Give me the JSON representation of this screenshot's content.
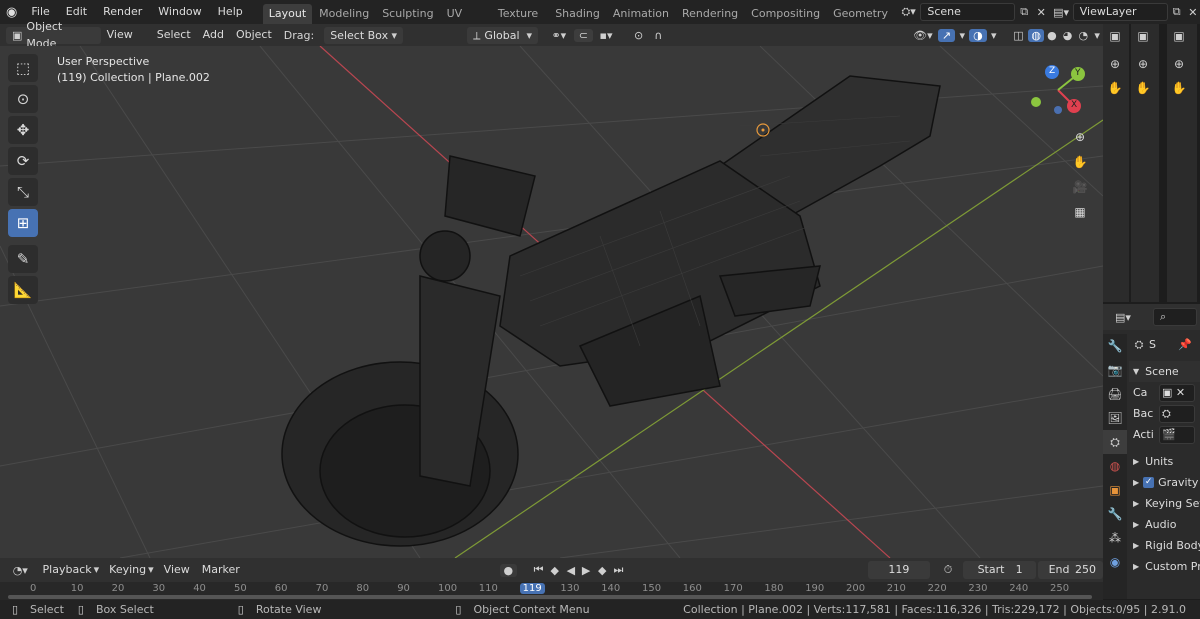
{
  "menubar": {
    "items": [
      "File",
      "Edit",
      "Render",
      "Window",
      "Help"
    ],
    "workspaces": [
      "Layout",
      "Modeling",
      "Sculpting",
      "UV Editing",
      "Texture Paint",
      "Shading",
      "Animation",
      "Rendering",
      "Compositing",
      "Geometry Nod"
    ],
    "active_workspace": "Layout",
    "scene": "Scene",
    "view_layer": "ViewLayer"
  },
  "header": {
    "mode": "Object Mode",
    "menus": [
      "View",
      "Select",
      "Add",
      "Object"
    ],
    "drag_label": "Drag:",
    "drag_value": "Select Box",
    "transform_orientation": "Global"
  },
  "viewport": {
    "view_name": "User Perspective",
    "collection_info": "(119) Collection | Plane.002",
    "gizmo_axes": {
      "x": "X",
      "y": "Y",
      "z": "Z"
    },
    "axis_colors": {
      "x": "#e0404f",
      "y": "#8bc53f",
      "z": "#3a7be0"
    }
  },
  "properties": {
    "search_placeholder": "",
    "breadcrumb": "S",
    "section": "Scene",
    "fields": [
      {
        "label": "Ca"
      },
      {
        "label": "Bac"
      },
      {
        "label": "Acti"
      }
    ],
    "panels": [
      "Units",
      "Gravity",
      "Keying Set",
      "Audio",
      "Rigid Body",
      "Custom Pr"
    ],
    "gravity_checked": true
  },
  "timeline": {
    "menus": [
      "Playback",
      "Keying",
      "View",
      "Marker"
    ],
    "current_frame": "119",
    "start_label": "Start",
    "start_value": "1",
    "end_label": "End",
    "end_value": "250",
    "ruler": [
      "0",
      "10",
      "20",
      "30",
      "40",
      "50",
      "60",
      "70",
      "80",
      "90",
      "100",
      "110",
      "119",
      "130",
      "140",
      "150",
      "160",
      "170",
      "180",
      "190",
      "200",
      "210",
      "220",
      "230",
      "240",
      "250"
    ],
    "playhead": "119"
  },
  "statusbar": {
    "select": "Select",
    "box_select": "Box Select",
    "rotate_view": "Rotate View",
    "context_menu": "Object Context Menu",
    "stats": "Collection | Plane.002 | Verts:117,581 | Faces:116,326 | Tris:229,172 | Objects:0/95 | 2.91.0"
  }
}
